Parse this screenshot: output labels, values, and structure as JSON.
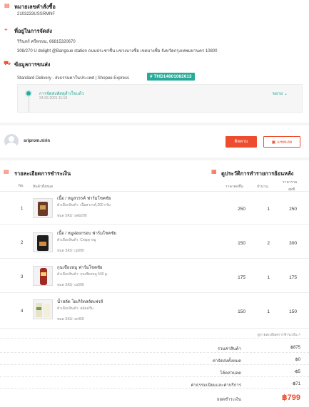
{
  "order_number": {
    "title": "หมายเลขคำสั่งซื้อ",
    "value": "2103233USSRMNF"
  },
  "shipping_address": {
    "title": "ที่อยู่ในการจัดส่ง",
    "name_phone": "วิรินทร์ ศรีพรหม, 66815320670",
    "address": "308/270 U delight @Bangsue station ถนนประชาชื่น แขวงบางซื่อ เขตบางซื่อ จังหวัดกรุงเทพมหานคร 10800"
  },
  "shipping_info": {
    "title": "ข้อมูลการขนส่ง",
    "service": "Standard Delivery - ส่งธรรมดาในประเทศ | Shopee Express",
    "tracking": "# THD14801082613",
    "status": "การจัดส่งพัสดุสำเร็จแล้ว",
    "status_time": "24-03-2021 11:19",
    "expand_label": "ขยาย"
  },
  "seller": {
    "name": "sriprom.nirin",
    "follow_label": "ติดตาม",
    "chat_label": "แชทเลย"
  },
  "payment_section": {
    "title": "รายละเอียดการชำระเงิน",
    "history_title": "ดูประวัติการทำรายการย้อนหลัง"
  },
  "table": {
    "headers": {
      "no": "No.",
      "product": "สินค้าทั้งหมด",
      "unit_price": "ราคาต่อชิ้น",
      "qty": "จำนวน",
      "subtotal_line1": "ราคารวม",
      "subtotal_line2": "สุทธิ"
    },
    "rows": [
      {
        "no": "1",
        "name": "เนื้อ / หมูสวรรค์ ฟาร์มโชคชัย",
        "variant": "ตัวเลือกสินค้า: เนื้อสวรรค์,200 กรัม",
        "sku": "หมด SKU: swb200",
        "price": "250",
        "qty": "1",
        "subtotal": "250"
      },
      {
        "no": "2",
        "name": "เนื้อ / หมูฝอยกรอบ ฟาร์มโชคชัย",
        "variant": "ตัวเลือกสินค้า: Crispy หมู",
        "sku": "หมด SKU: cp050",
        "price": "150",
        "qty": "2",
        "subtotal": "300"
      },
      {
        "no": "3",
        "name": "กุนเชียงหมู ฟาร์มโชคชัย",
        "variant": "ตัวเลือกสินค้า: กุนเชียงหมู 500 g.",
        "sku": "หมด SKU: cs500",
        "price": "175",
        "qty": "1",
        "subtotal": "175"
      },
      {
        "no": "4",
        "name": "น้ำสลัด โยเกิร์ตสลัดเฟรส์",
        "variant": "ตัวเลือกสินค้า: สลัดครีม",
        "sku": "หมด SKU: sc450",
        "price": "150",
        "qty": "1",
        "subtotal": "150"
      }
    ]
  },
  "summary": {
    "detail_link": "ดูรายละเอียดการชำระเงิน",
    "rows": [
      {
        "label": "รวมค่าสินค้า",
        "value": "฿875"
      },
      {
        "label": "ค่าจัดส่งทั้งหมด",
        "value": "฿0"
      },
      {
        "label": "โค้ดส่วนลด",
        "value": "-฿5"
      },
      {
        "label": "ค่าธรรมเนียมและค่าบริการ",
        "value": "-฿71"
      }
    ],
    "total_label": "ยอดชำระเงิน",
    "total_value": "฿799"
  },
  "colors": {
    "accent": "#ee4d2d",
    "teal": "#26aa99"
  }
}
